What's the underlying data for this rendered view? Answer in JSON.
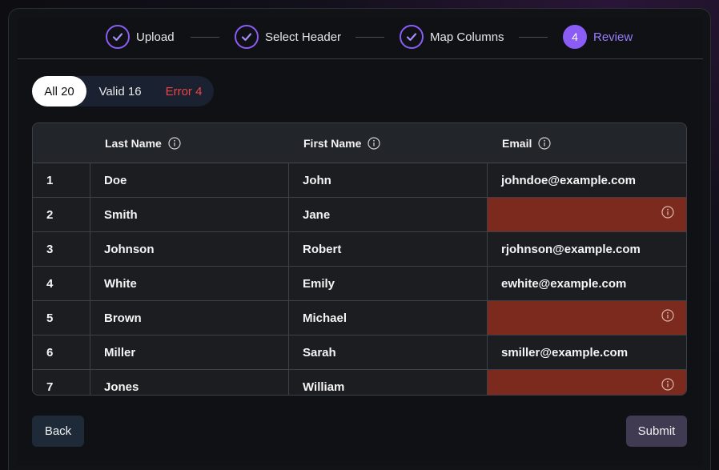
{
  "stepper": {
    "steps": [
      {
        "label": "Upload",
        "state": "done"
      },
      {
        "label": "Select Header",
        "state": "done"
      },
      {
        "label": "Map Columns",
        "state": "done"
      },
      {
        "label": "Review",
        "number": "4",
        "state": "active"
      }
    ]
  },
  "filters": {
    "all": "All 20",
    "valid": "Valid 16",
    "error": "Error 4"
  },
  "table": {
    "headers": [
      "Last Name",
      "First Name",
      "Email"
    ],
    "rows": [
      {
        "num": "1",
        "last": "Doe",
        "first": "John",
        "email": "johndoe@example.com",
        "error": false
      },
      {
        "num": "2",
        "last": "Smith",
        "first": "Jane",
        "email": "",
        "error": true
      },
      {
        "num": "3",
        "last": "Johnson",
        "first": "Robert",
        "email": "rjohnson@example.com",
        "error": false
      },
      {
        "num": "4",
        "last": "White",
        "first": "Emily",
        "email": "ewhite@example.com",
        "error": false
      },
      {
        "num": "5",
        "last": "Brown",
        "first": "Michael",
        "email": "",
        "error": true
      },
      {
        "num": "6",
        "last": "Miller",
        "first": "Sarah",
        "email": "smiller@example.com",
        "error": false
      },
      {
        "num": "7",
        "last": "Jones",
        "first": "William",
        "email": "",
        "error": true
      }
    ]
  },
  "actions": {
    "back": "Back",
    "submit": "Submit"
  },
  "colors": {
    "accent": "#8b5cf6",
    "error_text": "#ef4444",
    "error_cell": "#7c2a1e"
  }
}
